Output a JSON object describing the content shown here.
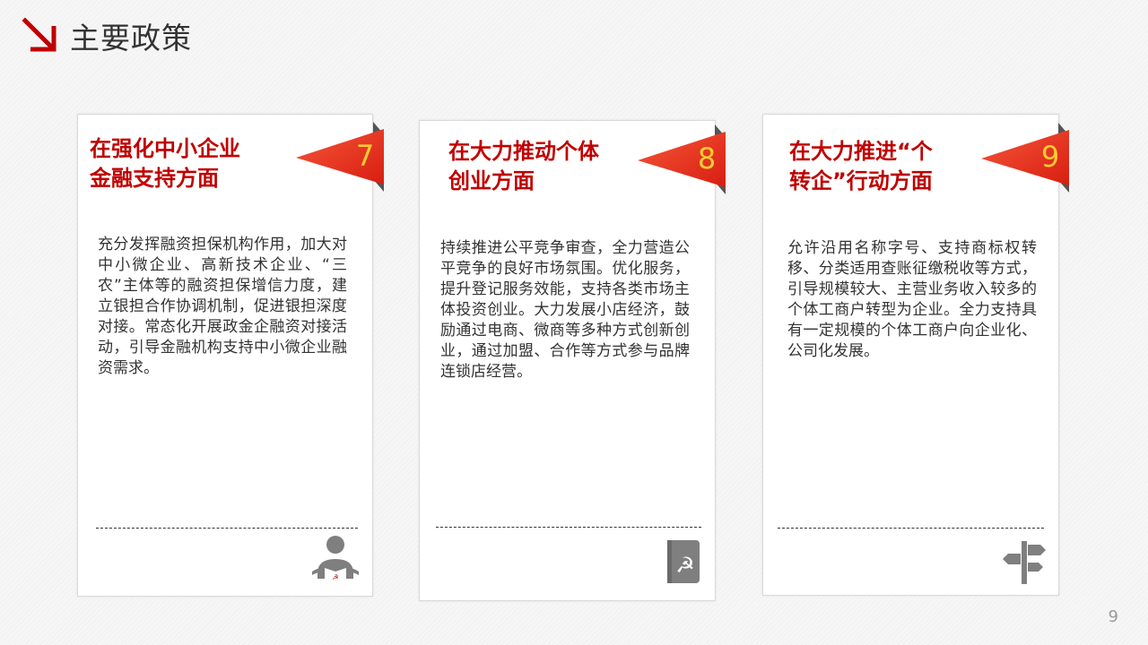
{
  "header": {
    "title": "主要政策"
  },
  "cards": [
    {
      "title_line1": "在强化中小企业",
      "title_line2": "金融支持方面",
      "number": "7",
      "body": "充分发挥融资担保机构作用，加大对中小微企业、高新技术企业、“三农”主体等的融资担保增信力度，建立银担合作协调机制，促进银担深度对接。常态化开展政金企融资对接活动，引导金融机构支持中小微企业融资需求。",
      "icon": "person-reading-icon"
    },
    {
      "title_line1": "在大力推动个体",
      "title_line2": "创业方面",
      "number": "8",
      "body": "持续推进公平竞争审查，全力营造公平竞争的良好市场氛围。优化服务，提升登记服务效能，支持各类市场主体投资创业。大力发展小店经济，鼓励通过电商、微商等多种方式创新创业，通过加盟、合作等方式参与品牌连锁店经营。",
      "icon": "party-book-icon"
    },
    {
      "title_line1": "在大力推进“个",
      "title_line2": "转企”行动方面",
      "number": "9",
      "body": "允许沿用名称字号、支持商标权转移、分类适用查账征缴税收等方式，引导规模较大、主营业务收入较多的个体工商户转型为企业。全力支持具有一定规模的个体工商户向企业化、公司化发展。",
      "icon": "signpost-icon"
    }
  ],
  "page_number": "9",
  "colors": {
    "accent": "#c00000",
    "flag": "#ee3322",
    "number": "#ffcc33"
  }
}
